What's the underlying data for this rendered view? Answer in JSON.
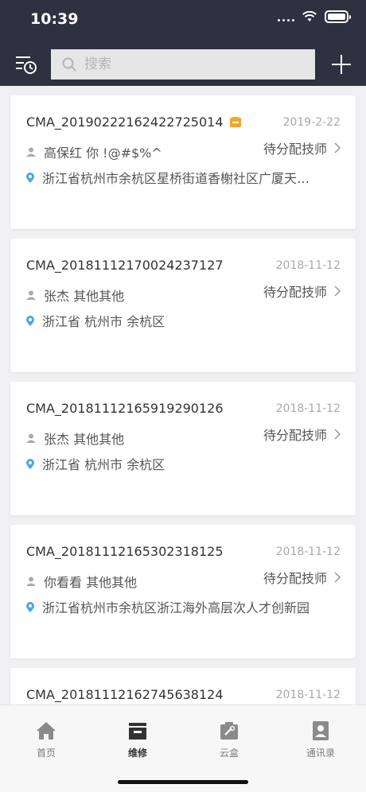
{
  "status_bar": {
    "time": "10:39"
  },
  "header": {
    "search_placeholder": "搜索"
  },
  "orders": [
    {
      "id": "CMA_20190222162422725014",
      "date": "2019-2-22",
      "customer": "高保红  你      !@#$%^",
      "status": "待分配技师",
      "address": "浙江省杭州市余杭区星桥街道香榭社区广厦天…",
      "has_tag": true
    },
    {
      "id": "CMA_20181112170024237127",
      "date": "2018-11-12",
      "customer": "张杰 其他其他",
      "status": "待分配技师",
      "address": "浙江省 杭州市 余杭区",
      "has_tag": false
    },
    {
      "id": "CMA_20181112165919290126",
      "date": "2018-11-12",
      "customer": "张杰 其他其他",
      "status": "待分配技师",
      "address": "浙江省 杭州市 余杭区",
      "has_tag": false
    },
    {
      "id": "CMA_20181112165302318125",
      "date": "2018-11-12",
      "customer": "你看看 其他其他",
      "status": "待分配技师",
      "address": "浙江省杭州市余杭区浙江海外高层次人才创新园",
      "has_tag": false
    },
    {
      "id": "CMA_20181112162745638124",
      "date": "2018-11-12",
      "customer": "",
      "status": "",
      "address": "",
      "has_tag": false
    }
  ],
  "tabs": [
    {
      "label": "首页",
      "icon": "home-icon"
    },
    {
      "label": "维修",
      "icon": "repair-box-icon"
    },
    {
      "label": "云盒",
      "icon": "cloud-box-icon"
    },
    {
      "label": "通讯录",
      "icon": "contacts-icon"
    }
  ],
  "colors": {
    "header": "#2d3140",
    "accent": "#f5a623",
    "pin": "#4aa8e0",
    "active_tab": "#333333"
  }
}
